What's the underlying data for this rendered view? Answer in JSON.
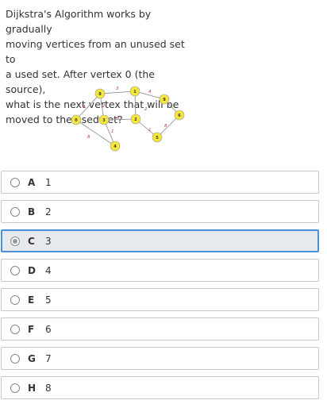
{
  "question": {
    "text": "Dijkstra's Algorithm works by gradually\nmoving vertices from an unused set to\na used set. After vertex 0 (the source),\nwhat is the next vertex that will be\nmoved to the used set?"
  },
  "graph": {
    "node_color": "#f5e63c",
    "edge_color": "#888888",
    "weight_color": "#c0392b",
    "nodes": [
      {
        "id": "n8",
        "label": "8"
      },
      {
        "id": "n1",
        "label": "1"
      },
      {
        "id": "n9",
        "label": "9"
      },
      {
        "id": "n6",
        "label": "6"
      },
      {
        "id": "n3",
        "label": "3"
      },
      {
        "id": "n0",
        "label": "0"
      },
      {
        "id": "n2",
        "label": "2"
      },
      {
        "id": "n5",
        "label": "5"
      },
      {
        "id": "n4",
        "label": "4"
      }
    ],
    "weights": [
      "3",
      "4",
      "4",
      "2",
      "2",
      "6",
      "8",
      "1",
      "1",
      "8"
    ]
  },
  "options": [
    {
      "letter": "A",
      "value": "1",
      "selected": false
    },
    {
      "letter": "B",
      "value": "2",
      "selected": false
    },
    {
      "letter": "C",
      "value": "3",
      "selected": true
    },
    {
      "letter": "D",
      "value": "4",
      "selected": false
    },
    {
      "letter": "E",
      "value": "5",
      "selected": false
    },
    {
      "letter": "F",
      "value": "6",
      "selected": false
    },
    {
      "letter": "G",
      "value": "7",
      "selected": false
    },
    {
      "letter": "H",
      "value": "8",
      "selected": false
    }
  ]
}
